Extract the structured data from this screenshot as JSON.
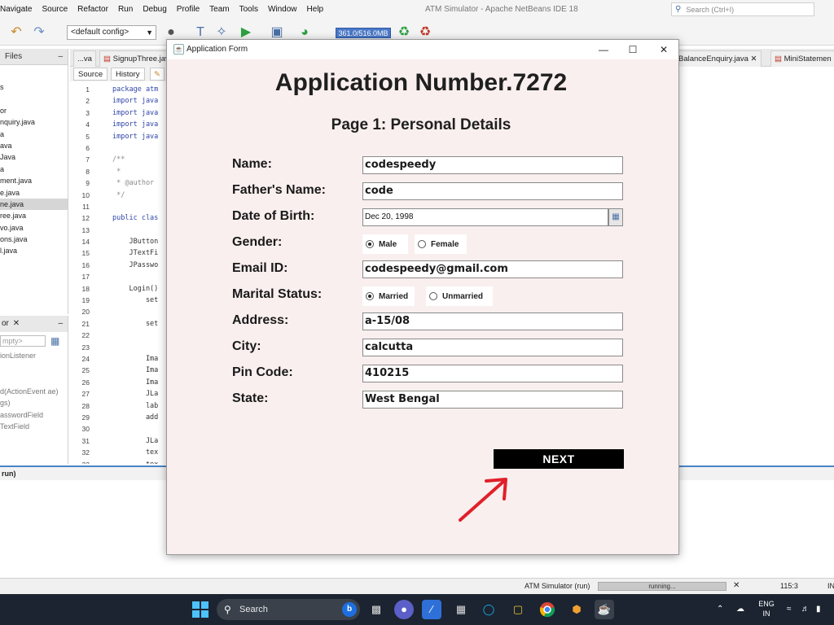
{
  "ide": {
    "menu": [
      "Navigate",
      "Source",
      "Refactor",
      "Run",
      "Debug",
      "Profile",
      "Team",
      "Tools",
      "Window",
      "Help"
    ],
    "title": "ATM Simulator - Apache NetBeans IDE 18",
    "search_placeholder": "Search (Ctrl+I)",
    "config_select": "<default config>",
    "memory": "361.0/516.0MB",
    "files_tab": "Files",
    "files": [
      "s",
      "",
      "or",
      "nquiry.java",
      "a",
      "ava",
      "Java",
      "a",
      "ment.java",
      "e.java",
      "ne.java",
      "ree.java",
      "vo.java",
      "ons.java",
      "l.java"
    ],
    "selected_file_index": 10,
    "navigator_tab": "or",
    "navigator_combo": "mpty>",
    "navigator_rows": [
      "ionListener",
      "",
      "",
      "d(ActionEvent ae)",
      "gs)",
      "asswordField",
      "TextField"
    ],
    "editor_tabs": [
      "...va",
      "SignupThree.jav",
      "BalanceEnquiry.java",
      "MiniStatemen"
    ],
    "source_btn": "Source",
    "history_btn": "History",
    "line_numbers": [
      "1",
      "2",
      "3",
      "4",
      "5",
      "6",
      "7",
      "8",
      "9",
      "10",
      "11",
      "12",
      "13",
      "14",
      "15",
      "16",
      "17",
      "18",
      "19",
      "20",
      "21",
      "22",
      "23",
      "24",
      "25",
      "26",
      "27",
      "28",
      "29",
      "30",
      "31",
      "32",
      "33"
    ],
    "code_lines": [
      "package atm",
      "import java",
      "import java",
      "import java",
      "import java",
      "",
      "/**",
      " *",
      " * @author",
      " */",
      "",
      "public clas",
      "",
      "    JButton",
      "    JTextFi",
      "    JPasswo",
      "",
      "    Login()",
      "        set",
      "",
      "        set",
      "",
      "",
      "        Ima",
      "        Ima",
      "        Ima",
      "        JLa",
      "        lab",
      "        add",
      "",
      "        JLa",
      "        tex",
      "        tex"
    ],
    "output_tab": "run)",
    "status_text": "ATM Simulator (run)",
    "status_progress_label": "running...",
    "status_position": "115:3",
    "status_ins": "IN"
  },
  "dialog": {
    "title": "Application Form",
    "minimize": "—",
    "maximize": "☐",
    "close": "✕",
    "heading": "Application Number.7272",
    "subheading": "Page 1: Personal Details",
    "labels": {
      "name": "Name:",
      "father": "Father's Name:",
      "dob": "Date of Birth:",
      "gender": "Gender:",
      "email": "Email ID:",
      "marital": "Marital Status:",
      "address": "Address:",
      "city": "City:",
      "pin": "Pin Code:",
      "state": "State:"
    },
    "values": {
      "name": "codespeedy",
      "father": "code",
      "dob": "Dec 20, 1998",
      "email": "codespeedy@gmail.com",
      "address": "a-15/08",
      "city": "calcutta",
      "pin": "410215",
      "state": "West Bengal"
    },
    "gender_options": [
      "Male",
      "Female"
    ],
    "gender_selected": "Male",
    "marital_options": [
      "Married",
      "Unmarried"
    ],
    "marital_selected": "Married",
    "next_label": "NEXT"
  },
  "taskbar": {
    "search_label": "Search",
    "lang_top": "ENG",
    "lang_bottom": "IN"
  },
  "colors": {
    "dialog_bg": "#f9efee",
    "next_bg": "#000000",
    "arrow": "#e0202a",
    "taskbar_bg": "#1b2430",
    "accent": "#4a84c7"
  }
}
